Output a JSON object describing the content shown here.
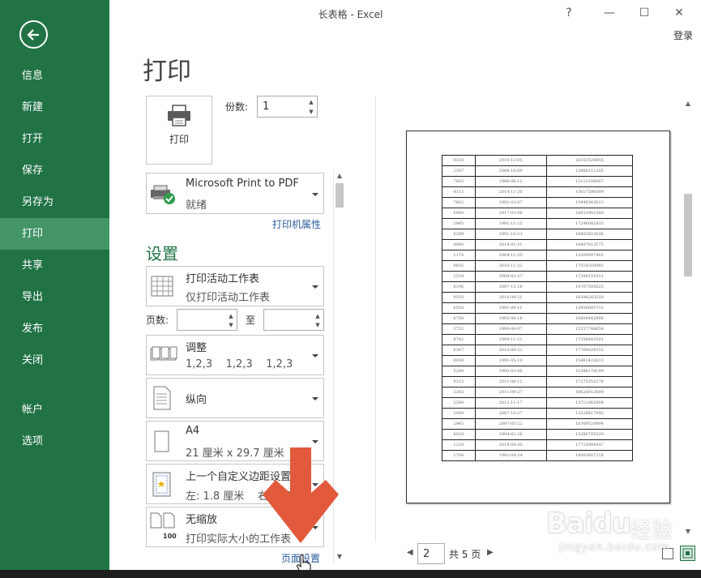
{
  "window": {
    "title": "长表格 - Excel",
    "help": "?",
    "minimize": "—",
    "maximize": "☐",
    "close": "✕",
    "login": "登录"
  },
  "sidebar": {
    "items": [
      {
        "label": "信息"
      },
      {
        "label": "新建"
      },
      {
        "label": "打开"
      },
      {
        "label": "保存"
      },
      {
        "label": "另存为"
      },
      {
        "label": "打印"
      },
      {
        "label": "共享"
      },
      {
        "label": "导出"
      },
      {
        "label": "发布"
      },
      {
        "label": "关闭"
      },
      {
        "label": "帐户"
      },
      {
        "label": "选项"
      }
    ],
    "active": "打印"
  },
  "print": {
    "title": "打印",
    "button_label": "打印",
    "copies_label": "份数:",
    "copies_value": "1"
  },
  "printer": {
    "name": "Microsoft Print to PDF",
    "status": "就绪",
    "properties_link": "打印机属性"
  },
  "settings": {
    "title": "设置",
    "scope": {
      "main": "打印活动工作表",
      "sub": "仅打印活动工作表"
    },
    "pages_label": "页数:",
    "to_label": "至",
    "collate": {
      "main": "调整",
      "sub": "1,2,3    1,2,3    1,2,3"
    },
    "orientation": {
      "main": "纵向"
    },
    "paper": {
      "main": "A4",
      "sub": "21 厘米 x 29.7 厘米"
    },
    "margins": {
      "main": "上一个自定义边距设置",
      "sub": "左: 1.8 厘米    右: 1.8"
    },
    "scaling": {
      "main": "无缩放",
      "sub": "打印实际大小的工作表",
      "icon_text": "100"
    },
    "page_setup_link": "页面设置"
  },
  "preview": {
    "pager": {
      "current": "2",
      "total": "共 5 页"
    },
    "rows": [
      [
        "9318",
        "2010-12-05",
        "18353529855"
      ],
      [
        "2307",
        "2008-10-09",
        "13866111205"
      ],
      [
        "7603",
        "1996-06-12",
        "13112100067"
      ],
      [
        "4112",
        "2014-11-20",
        "13617596099"
      ],
      [
        "7602",
        "1992-02-07",
        "13946363013"
      ],
      [
        "6900",
        "2017-03-08",
        "18653902580"
      ],
      [
        "2965",
        "1991-11-25",
        "17246082935"
      ],
      [
        "6209",
        "1991-10-23",
        "18862822636"
      ],
      [
        "4040",
        "2014-01-31",
        "18867813175"
      ],
      [
        "1178",
        "2004-11-25",
        "13209097465"
      ],
      [
        "9655",
        "2010-11-22",
        "17516359985"
      ],
      [
        "2518",
        "2009-02-27",
        "17208151921"
      ],
      [
        "6196",
        "2007-12-18",
        "14767595625"
      ],
      [
        "9503",
        "2016-08-21",
        "18394283250"
      ],
      [
        "6550",
        "1991-09-11",
        "13956695712"
      ],
      [
        "6708",
        "1992-08-18",
        "18609442906"
      ],
      [
        "3752",
        "1999-09-07",
        "12257748658"
      ],
      [
        "6742",
        "1994-11-21",
        "17356643501"
      ],
      [
        "6367",
        "2010-09-22",
        "17769029555"
      ],
      [
        "8030",
        "1991-05-10",
        "15461422613"
      ],
      [
        "5208",
        "1993-03-08",
        "15396178199"
      ],
      [
        "9313",
        "2011-06-12",
        "17275352576"
      ],
      [
        "2303",
        "2011-09-27",
        "18624913699"
      ],
      [
        "2300",
        "2012-11-17",
        "13711082908"
      ],
      [
        "2000",
        "2007-10-27",
        "13528617945"
      ],
      [
        "2945",
        "2007-05-22",
        "18769528994"
      ],
      [
        "8029",
        "1994-02-28",
        "15286705529"
      ],
      [
        "1228",
        "2019-09-30",
        "17725994547"
      ],
      [
        "1708",
        "1992-04-24",
        "14003607218"
      ]
    ]
  },
  "watermark": {
    "brand": "Bai",
    "brand2": "du",
    "cn": "经验",
    "url": "jingyan.baidu.com"
  },
  "colors": {
    "accent": "#217346",
    "accent_active": "#439467",
    "arrow": "#e2593b",
    "link": "#2a5b9b"
  }
}
